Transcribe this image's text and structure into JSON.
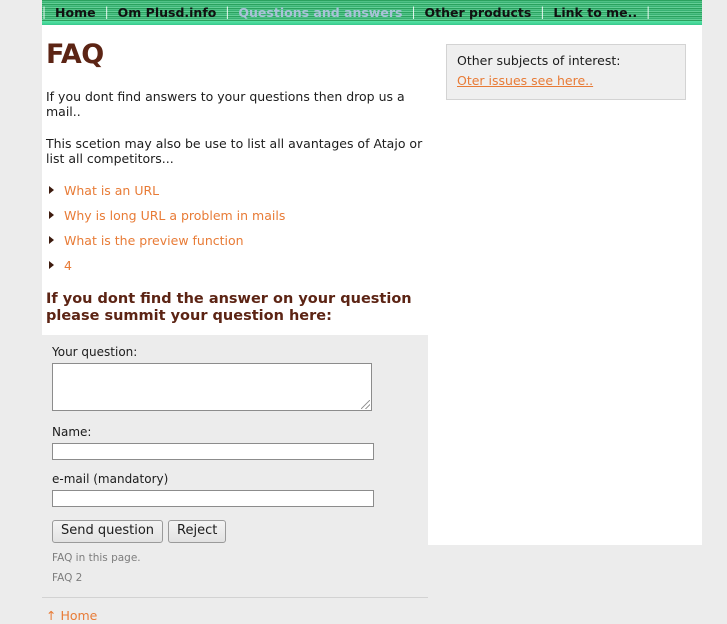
{
  "nav": {
    "separator": "|",
    "items": [
      {
        "label": "Home",
        "active": false
      },
      {
        "label": "Om Plusd.info",
        "active": false
      },
      {
        "label": "Questions and answers",
        "active": true
      },
      {
        "label": "Other products",
        "active": false
      },
      {
        "label": "Link to me..",
        "active": false
      }
    ]
  },
  "main": {
    "title": "FAQ",
    "intro": "If you dont find answers to your questions then drop us a mail..",
    "secondary": "This scetion may also be use to list all avantages of Atajo or list all competitors...",
    "faq_links": [
      "What is an URL",
      "Why is long URL a problem in mails",
      "What is the preview function",
      "4"
    ],
    "summit_heading": "If you dont find the answer on your question please summit your question here:"
  },
  "form": {
    "question_label": "Your question:",
    "question_value": "",
    "name_label": "Name:",
    "name_value": "",
    "email_label": "e-mail (mandatory)",
    "email_value": "",
    "send_button": "Send question",
    "reject_button": "Reject",
    "footnote_1": "FAQ in this page.",
    "footnote_2": "FAQ 2"
  },
  "sidebar": {
    "heading": "Other subjects of interest:",
    "link": "Oter issues see here.."
  },
  "footer": {
    "home_link": "↑ Home"
  },
  "colors": {
    "nav_green": "#2aa15e",
    "nav_green_light": "#63ce96",
    "heading_brown": "#5c2414",
    "link_orange": "#e87b36",
    "active_nav": "#a9c2d8",
    "panel_gray": "#ececec"
  }
}
